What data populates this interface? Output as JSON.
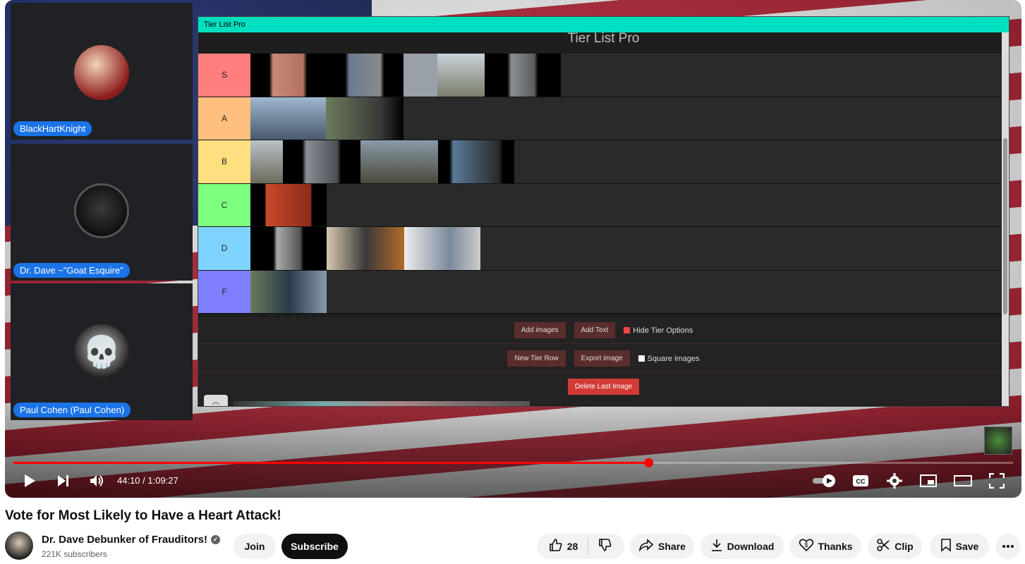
{
  "video": {
    "title": "Vote for Most Likely to Have a Heart Attack!",
    "time_current": "44:10",
    "time_total": "1:09:27",
    "time_display": "44:10 / 1:09:27",
    "progress": 0.635
  },
  "participants": [
    {
      "name": "BlackHartKnight"
    },
    {
      "name": "Dr. Dave ~\"Goat Esquire\""
    },
    {
      "name": "Paul Cohen (Paul Cohen)"
    }
  ],
  "tier_app": {
    "window_title": "Tier List Pro",
    "heading": "Tier List Pro",
    "tiers": [
      {
        "label": "S",
        "color": "#ff7f7f"
      },
      {
        "label": "A",
        "color": "#ffbf7f"
      },
      {
        "label": "B",
        "color": "#ffdf7f"
      },
      {
        "label": "C",
        "color": "#7fff7f"
      },
      {
        "label": "D",
        "color": "#7fd4ff"
      },
      {
        "label": "F",
        "color": "#7f7fff"
      }
    ],
    "buttons": {
      "add_images": "Add images",
      "add_text": "Add Text",
      "hide_tier_options": "Hide Tier Options",
      "new_tier_row": "New Tier Row",
      "export_image": "Export image",
      "square_images": "Square images",
      "delete_last_image": "Delete Last Image"
    }
  },
  "channel": {
    "name": "Dr. Dave Debunker of Frauditors!",
    "subscribers": "221K subscribers",
    "join_label": "Join",
    "subscribe_label": "Subscribe"
  },
  "actions": {
    "like_count": "28",
    "share_label": "Share",
    "download_label": "Download",
    "thanks_label": "Thanks",
    "clip_label": "Clip",
    "save_label": "Save"
  },
  "colors": {
    "accent": "#ff0000",
    "app_titlebar": "#00e0c0",
    "name_pill": "#1a73e8",
    "delete_button": "#d13b35"
  }
}
